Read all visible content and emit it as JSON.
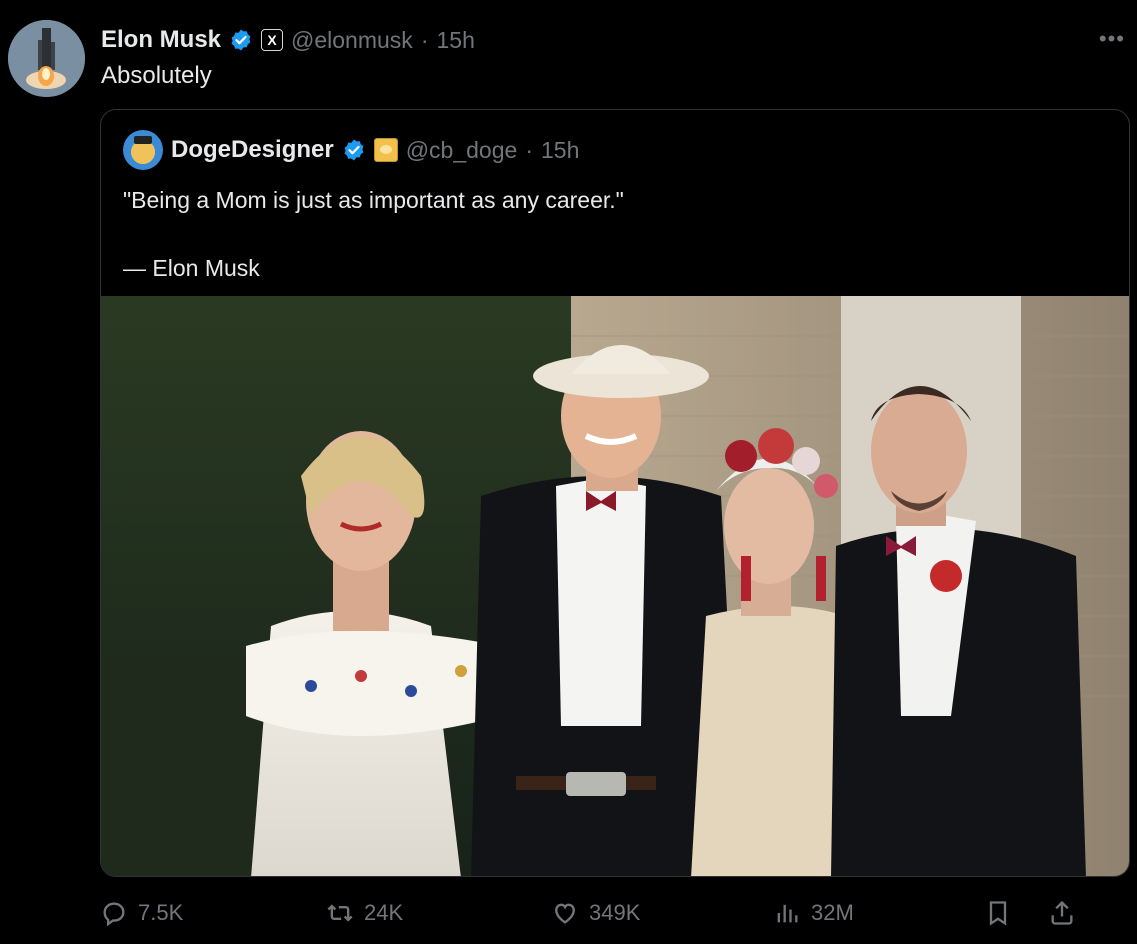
{
  "tweet": {
    "author_name": "Elon Musk",
    "handle": "@elonmusk",
    "separator": "·",
    "time": "15h",
    "affiliate_badge": "X",
    "text": "Absolutely",
    "more": "•••"
  },
  "quote": {
    "author_name": "DogeDesigner",
    "handle": "@cb_doge",
    "separator": "·",
    "time": "15h",
    "line1": "\"Being a Mom is just as important as any career.\"",
    "line2": "— Elon Musk"
  },
  "actions": {
    "replies": "7.5K",
    "reposts": "24K",
    "likes": "349K",
    "views": "32M"
  },
  "icons": {
    "reply": "reply-icon",
    "repost": "repost-icon",
    "like": "heart-icon",
    "views": "views-icon",
    "bookmark": "bookmark-icon",
    "share": "share-icon",
    "verified": "verified-badge-icon"
  },
  "colors": {
    "background": "#000000",
    "text": "#e7e9ea",
    "muted": "#71767b",
    "verified": "#1d9bf0",
    "border": "#2f3336"
  }
}
